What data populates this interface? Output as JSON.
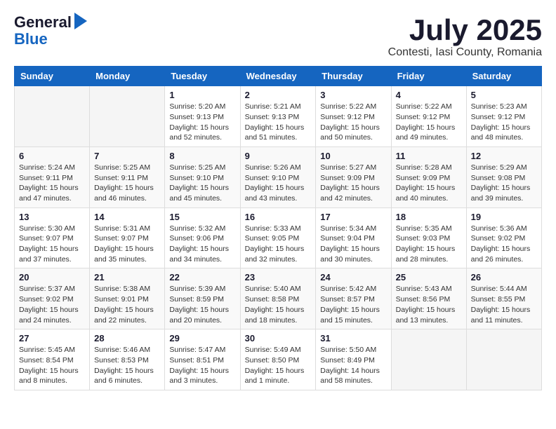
{
  "logo": {
    "general": "General",
    "blue": "Blue"
  },
  "title": {
    "month_year": "July 2025",
    "location": "Contesti, Iasi County, Romania"
  },
  "weekdays": [
    "Sunday",
    "Monday",
    "Tuesday",
    "Wednesday",
    "Thursday",
    "Friday",
    "Saturday"
  ],
  "weeks": [
    [
      {
        "day": "",
        "info": ""
      },
      {
        "day": "",
        "info": ""
      },
      {
        "day": "1",
        "info": "Sunrise: 5:20 AM\nSunset: 9:13 PM\nDaylight: 15 hours\nand 52 minutes."
      },
      {
        "day": "2",
        "info": "Sunrise: 5:21 AM\nSunset: 9:13 PM\nDaylight: 15 hours\nand 51 minutes."
      },
      {
        "day": "3",
        "info": "Sunrise: 5:22 AM\nSunset: 9:12 PM\nDaylight: 15 hours\nand 50 minutes."
      },
      {
        "day": "4",
        "info": "Sunrise: 5:22 AM\nSunset: 9:12 PM\nDaylight: 15 hours\nand 49 minutes."
      },
      {
        "day": "5",
        "info": "Sunrise: 5:23 AM\nSunset: 9:12 PM\nDaylight: 15 hours\nand 48 minutes."
      }
    ],
    [
      {
        "day": "6",
        "info": "Sunrise: 5:24 AM\nSunset: 9:11 PM\nDaylight: 15 hours\nand 47 minutes."
      },
      {
        "day": "7",
        "info": "Sunrise: 5:25 AM\nSunset: 9:11 PM\nDaylight: 15 hours\nand 46 minutes."
      },
      {
        "day": "8",
        "info": "Sunrise: 5:25 AM\nSunset: 9:10 PM\nDaylight: 15 hours\nand 45 minutes."
      },
      {
        "day": "9",
        "info": "Sunrise: 5:26 AM\nSunset: 9:10 PM\nDaylight: 15 hours\nand 43 minutes."
      },
      {
        "day": "10",
        "info": "Sunrise: 5:27 AM\nSunset: 9:09 PM\nDaylight: 15 hours\nand 42 minutes."
      },
      {
        "day": "11",
        "info": "Sunrise: 5:28 AM\nSunset: 9:09 PM\nDaylight: 15 hours\nand 40 minutes."
      },
      {
        "day": "12",
        "info": "Sunrise: 5:29 AM\nSunset: 9:08 PM\nDaylight: 15 hours\nand 39 minutes."
      }
    ],
    [
      {
        "day": "13",
        "info": "Sunrise: 5:30 AM\nSunset: 9:07 PM\nDaylight: 15 hours\nand 37 minutes."
      },
      {
        "day": "14",
        "info": "Sunrise: 5:31 AM\nSunset: 9:07 PM\nDaylight: 15 hours\nand 35 minutes."
      },
      {
        "day": "15",
        "info": "Sunrise: 5:32 AM\nSunset: 9:06 PM\nDaylight: 15 hours\nand 34 minutes."
      },
      {
        "day": "16",
        "info": "Sunrise: 5:33 AM\nSunset: 9:05 PM\nDaylight: 15 hours\nand 32 minutes."
      },
      {
        "day": "17",
        "info": "Sunrise: 5:34 AM\nSunset: 9:04 PM\nDaylight: 15 hours\nand 30 minutes."
      },
      {
        "day": "18",
        "info": "Sunrise: 5:35 AM\nSunset: 9:03 PM\nDaylight: 15 hours\nand 28 minutes."
      },
      {
        "day": "19",
        "info": "Sunrise: 5:36 AM\nSunset: 9:02 PM\nDaylight: 15 hours\nand 26 minutes."
      }
    ],
    [
      {
        "day": "20",
        "info": "Sunrise: 5:37 AM\nSunset: 9:02 PM\nDaylight: 15 hours\nand 24 minutes."
      },
      {
        "day": "21",
        "info": "Sunrise: 5:38 AM\nSunset: 9:01 PM\nDaylight: 15 hours\nand 22 minutes."
      },
      {
        "day": "22",
        "info": "Sunrise: 5:39 AM\nSunset: 8:59 PM\nDaylight: 15 hours\nand 20 minutes."
      },
      {
        "day": "23",
        "info": "Sunrise: 5:40 AM\nSunset: 8:58 PM\nDaylight: 15 hours\nand 18 minutes."
      },
      {
        "day": "24",
        "info": "Sunrise: 5:42 AM\nSunset: 8:57 PM\nDaylight: 15 hours\nand 15 minutes."
      },
      {
        "day": "25",
        "info": "Sunrise: 5:43 AM\nSunset: 8:56 PM\nDaylight: 15 hours\nand 13 minutes."
      },
      {
        "day": "26",
        "info": "Sunrise: 5:44 AM\nSunset: 8:55 PM\nDaylight: 15 hours\nand 11 minutes."
      }
    ],
    [
      {
        "day": "27",
        "info": "Sunrise: 5:45 AM\nSunset: 8:54 PM\nDaylight: 15 hours\nand 8 minutes."
      },
      {
        "day": "28",
        "info": "Sunrise: 5:46 AM\nSunset: 8:53 PM\nDaylight: 15 hours\nand 6 minutes."
      },
      {
        "day": "29",
        "info": "Sunrise: 5:47 AM\nSunset: 8:51 PM\nDaylight: 15 hours\nand 3 minutes."
      },
      {
        "day": "30",
        "info": "Sunrise: 5:49 AM\nSunset: 8:50 PM\nDaylight: 15 hours\nand 1 minute."
      },
      {
        "day": "31",
        "info": "Sunrise: 5:50 AM\nSunset: 8:49 PM\nDaylight: 14 hours\nand 58 minutes."
      },
      {
        "day": "",
        "info": ""
      },
      {
        "day": "",
        "info": ""
      }
    ]
  ]
}
